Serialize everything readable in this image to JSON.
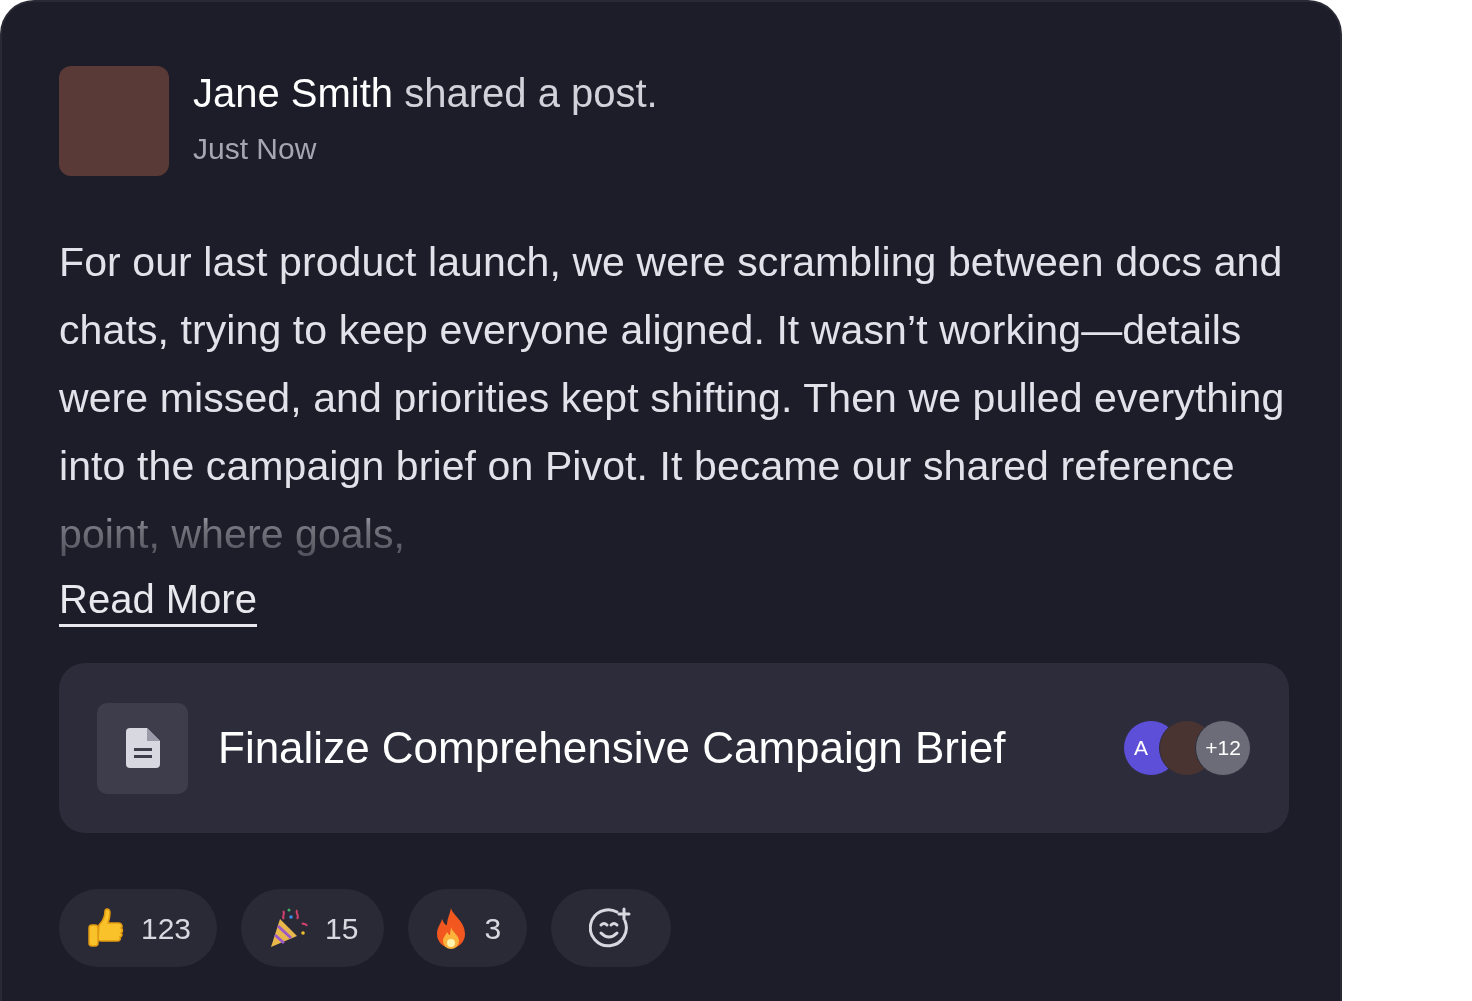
{
  "post": {
    "author": "Jane Smith",
    "action": "shared a post.",
    "time": "Just Now",
    "body": "For our last product launch, we were scrambling between docs and chats, trying to keep everyone aligned. It wasn’t working—details were missed, and priorities kept shifting. Then we pulled everything into the campaign brief on Pivot. It became our shared reference point, where goals,",
    "truncated": true,
    "read_more": "Read More"
  },
  "attachment": {
    "title": "Finalize Comprehensive Campaign Brief",
    "avatars": [
      {
        "kind": "initials",
        "text": "A",
        "color": "#5e4fd8"
      },
      {
        "kind": "photo"
      },
      {
        "kind": "count",
        "text": "+12"
      }
    ]
  },
  "reactions": [
    {
      "kind": "thumbs_up",
      "count": "123"
    },
    {
      "kind": "party",
      "count": "15"
    },
    {
      "kind": "fire",
      "count": "3"
    },
    {
      "kind": "add"
    }
  ]
}
